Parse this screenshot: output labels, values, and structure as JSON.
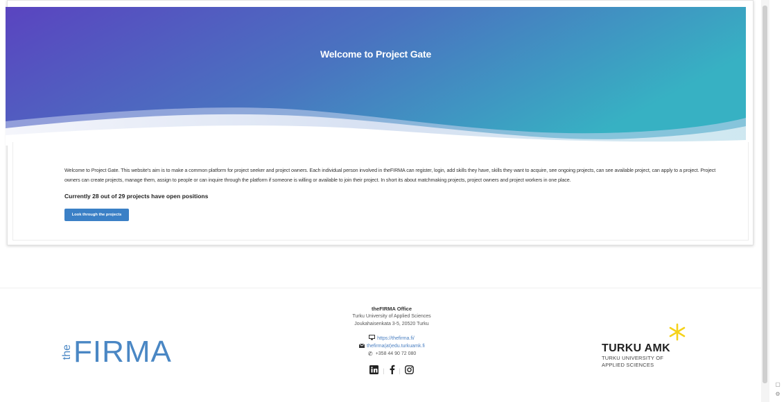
{
  "hero": {
    "title": "Welcome to Project Gate"
  },
  "intro": {
    "paragraph": "Welcome to Project Gate. This website's aim is to make a common platform for project seeker and project owners. Each individual person involved in theFIRMA can register, login, add skills they have, skills they want to acquire, see ongoing projects, can see available project, can apply to a project. Project owners can create projects, manage them, assign to people or can inquire through the platform if someone is willing or available to join their project. In short its about matchmaking projects, project owners and project workers in one place.",
    "open_positions": "Currently 28 out of 29 projects have open positions",
    "button_label": "Look through the projects"
  },
  "footer": {
    "logo_the": "the",
    "logo_firma": "FIRMA",
    "office_title": "theFIRMA Office",
    "office_line1": "Turku University of Applied Sciences",
    "office_line2": "Joukahaisenkata 3-5, 20520 Turku",
    "website": "https://thefirma.fi/",
    "email": "thefirma(at)edu.turkuamk.fi",
    "phone": "+358 44 90 72 080",
    "social": [
      "linkedin-icon",
      "facebook-icon",
      "instagram-icon"
    ],
    "turku_name": "TURKU AMK",
    "turku_sub1": "TURKU UNIVERSITY OF",
    "turku_sub2": "APPLIED SCIENCES"
  },
  "colors": {
    "hero_start": "#5a46c0",
    "hero_end": "#3ab0c4",
    "button": "#3b80c6",
    "logo_blue": "#4a87c4",
    "turku_star": "#f5d21a"
  }
}
